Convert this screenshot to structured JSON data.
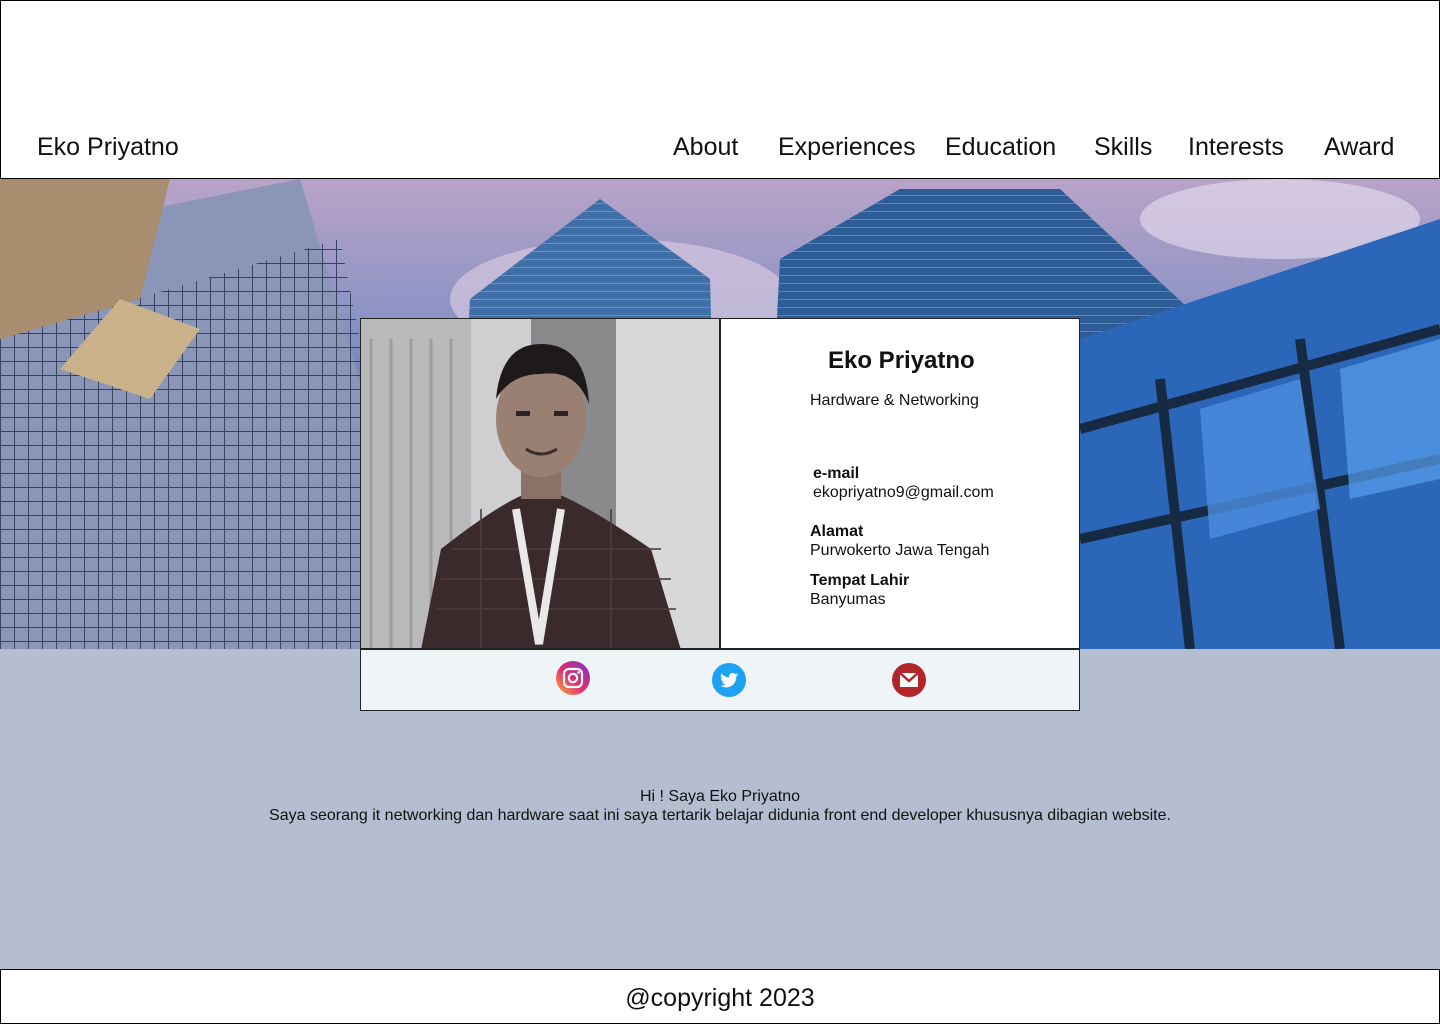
{
  "header": {
    "brand": "Eko Priyatno",
    "nav": [
      {
        "label": "About"
      },
      {
        "label": "Experiences"
      },
      {
        "label": "Education"
      },
      {
        "label": "Skills"
      },
      {
        "label": "Interests"
      },
      {
        "label": "Award"
      }
    ]
  },
  "profile": {
    "name": "Eko Priyatno",
    "role": "Hardware & Networking",
    "email_label": "e-mail",
    "email_value": "ekopriyatno9@gmail.com",
    "address_label": "Alamat",
    "address_value": "Purwokerto Jawa Tengah",
    "birthplace_label": "Tempat Lahir",
    "birthplace_value": "Banyumas"
  },
  "social": [
    {
      "icon": "instagram-icon"
    },
    {
      "icon": "twitter-icon"
    },
    {
      "icon": "gmail-icon"
    }
  ],
  "bio": {
    "line1": "Hi !  Saya Eko Priyatno",
    "line2": "Saya seorang it networking dan hardware  saat ini saya tertarik belajar didunia front end developer khususnya dibagian website."
  },
  "footer": {
    "copyright": "@copyright 2023"
  }
}
